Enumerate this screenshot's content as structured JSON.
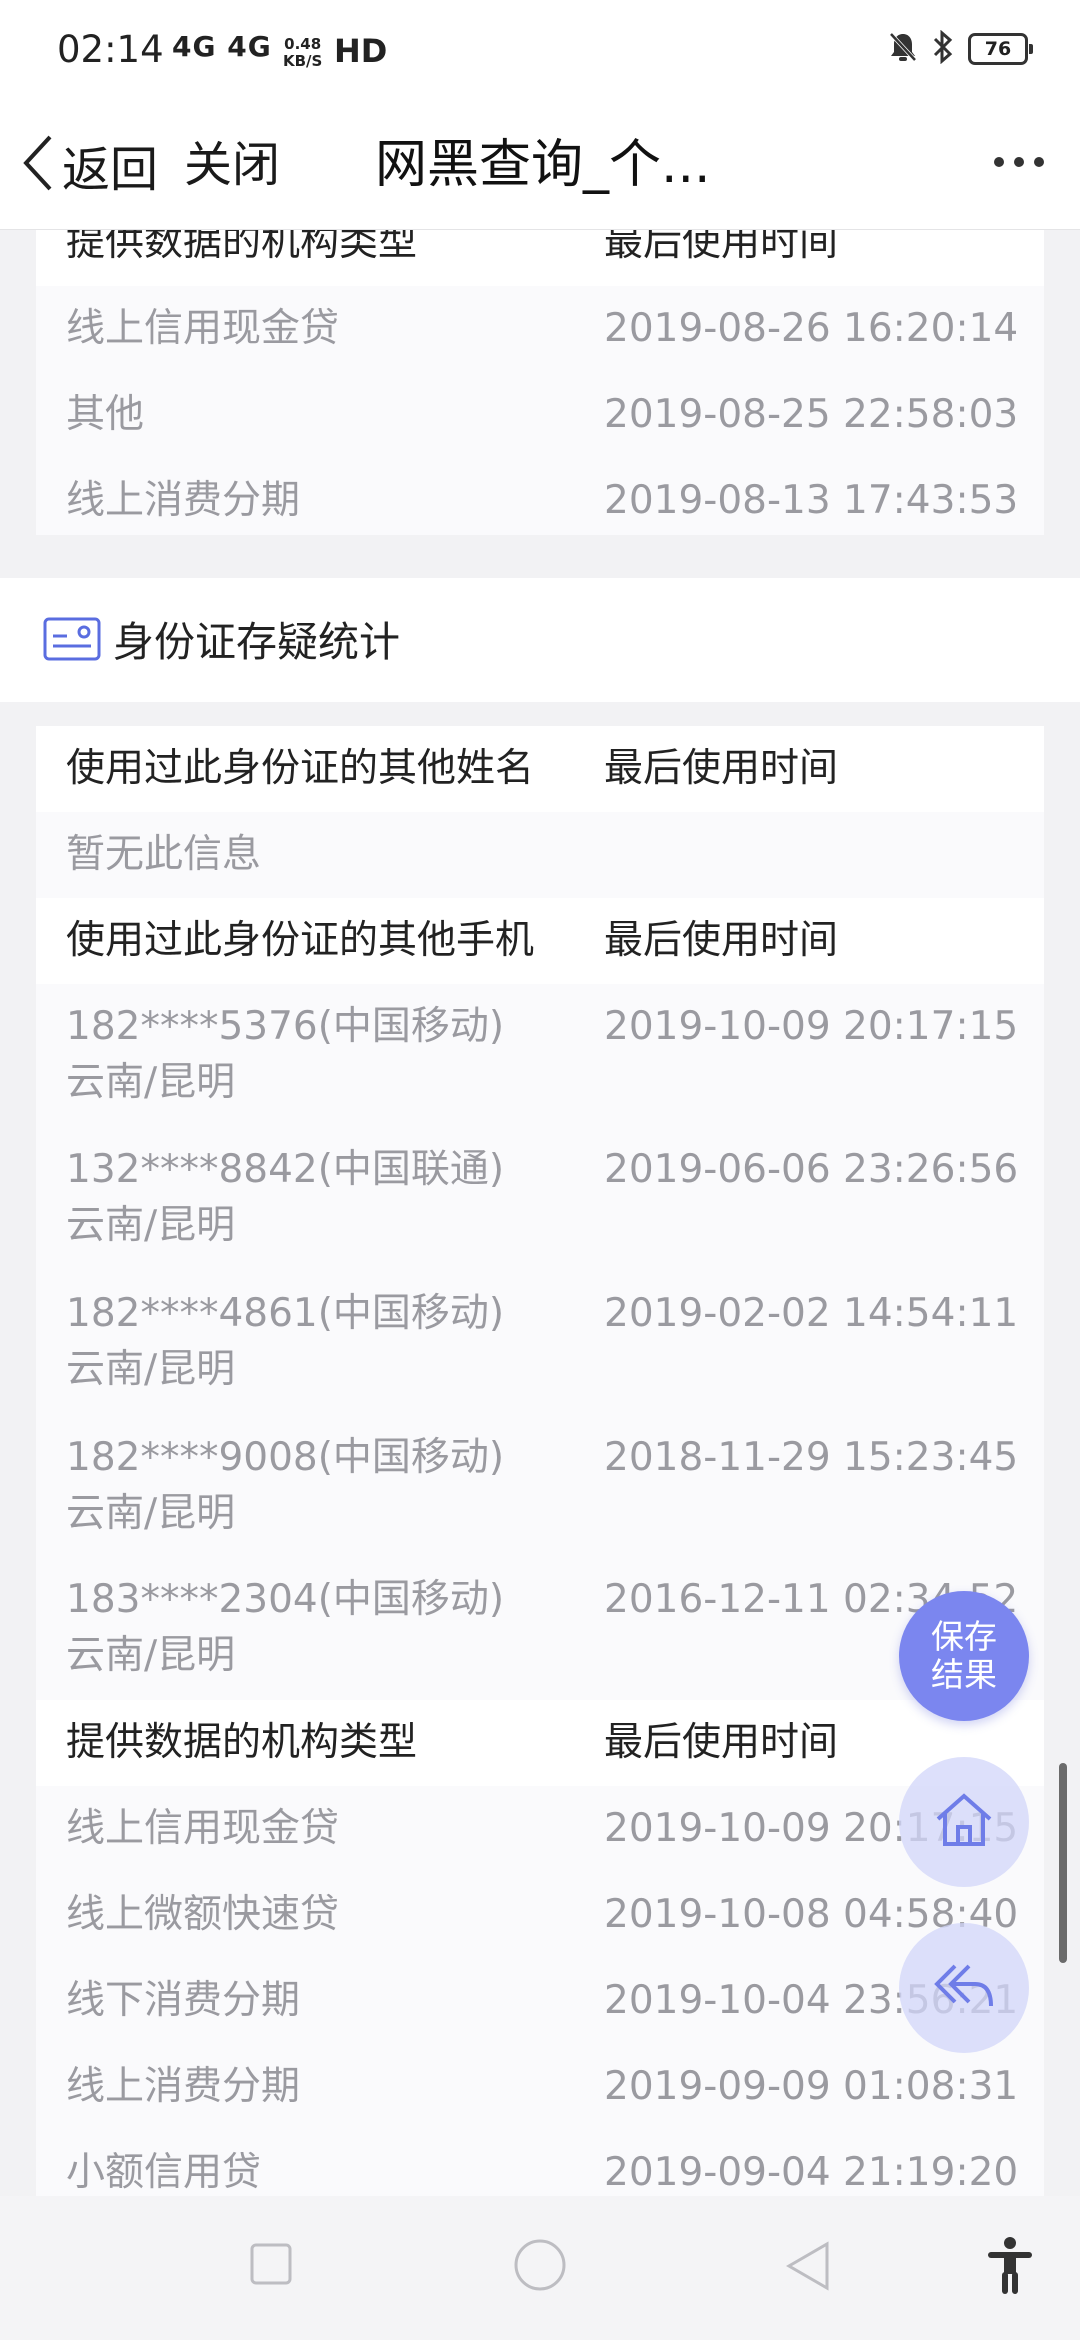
{
  "status_bar": {
    "time": "02:14",
    "network": "4G 4G",
    "speed_value": "0.48",
    "speed_unit": "KB/S",
    "hd": "HD",
    "battery": "76"
  },
  "nav": {
    "back_label": "返回",
    "close_label": "关闭",
    "title": "网黑查询_个..."
  },
  "top_section": {
    "header": {
      "col1": "提供数据的机构类型",
      "col2": "最后使用时间"
    },
    "rows": [
      {
        "col1": "线上信用现金贷",
        "col2": "2019-08-26 16:20:14"
      },
      {
        "col1": "其他",
        "col2": "2019-08-25 22:58:03"
      },
      {
        "col1": "线上消费分期",
        "col2": "2019-08-13 17:43:53"
      }
    ]
  },
  "id_section": {
    "title": "身份证存疑统计",
    "names_header": {
      "col1": "使用过此身份证的其他姓名",
      "col2": "最后使用时间"
    },
    "names_empty": "暂无此信息",
    "phones_header": {
      "col1": "使用过此身份证的其他手机",
      "col2": "最后使用时间"
    },
    "phones": [
      {
        "number": "182****5376(中国移动)",
        "location": "云南/昆明",
        "time": "2019-10-09 20:17:15"
      },
      {
        "number": "132****8842(中国联通)",
        "location": "云南/昆明",
        "time": "2019-06-06 23:26:56"
      },
      {
        "number": "182****4861(中国移动)",
        "location": "云南/昆明",
        "time": "2019-02-02 14:54:11"
      },
      {
        "number": "182****9008(中国移动)",
        "location": "云南/昆明",
        "time": "2018-11-29 15:23:45"
      },
      {
        "number": "183****2304(中国移动)",
        "location": "云南/昆明",
        "time": "2016-12-11 02:34:52"
      }
    ],
    "orgs_header": {
      "col1": "提供数据的机构类型",
      "col2": "最后使用时间"
    },
    "orgs": [
      {
        "col1": "线上信用现金贷",
        "col2": "2019-10-09 20:17:15"
      },
      {
        "col1": "线上微额快速贷",
        "col2": "2019-10-08 04:58:40"
      },
      {
        "col1": "线下消费分期",
        "col2": "2019-10-04 23:56:21"
      },
      {
        "col1": "线上消费分期",
        "col2": "2019-09-09 01:08:31"
      },
      {
        "col1": "小额信用贷",
        "col2": "2019-09-04 21:19:20"
      }
    ]
  },
  "fab": {
    "save_line1": "保存",
    "save_line2": "结果"
  },
  "colors": {
    "accent": "#7b86ef",
    "fab_light": "#d2d6fa",
    "muted_text": "#9a9aa0"
  }
}
